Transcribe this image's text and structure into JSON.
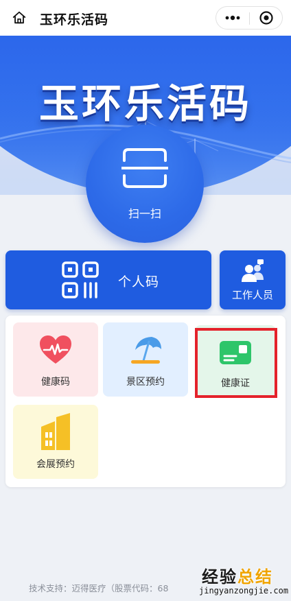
{
  "topbar": {
    "title": "玉环乐活码",
    "icons": {
      "home": "home-icon",
      "more": "more-dots-icon",
      "target": "target-circle-icon"
    }
  },
  "hero": {
    "title": "玉环乐活码",
    "scan_label": "扫一扫",
    "colors": {
      "primary": "#1f5ce0",
      "hero_top": "#1a3fd6"
    }
  },
  "actions": {
    "personal_code": "个人码",
    "staff": "工作人员"
  },
  "services": [
    {
      "label": "健康码",
      "icon": "heart-pulse-icon"
    },
    {
      "label": "景区预约",
      "icon": "beach-umbrella-icon"
    },
    {
      "label": "健康证",
      "icon": "id-card-icon"
    },
    {
      "label": "会展预约",
      "icon": "buildings-icon"
    }
  ],
  "footer": {
    "support": "技术支持：迈得医疗（股票代码：68"
  },
  "watermark": {
    "main_a": "经验",
    "main_b": "总结",
    "sub": "jingyanzongjie.com"
  }
}
